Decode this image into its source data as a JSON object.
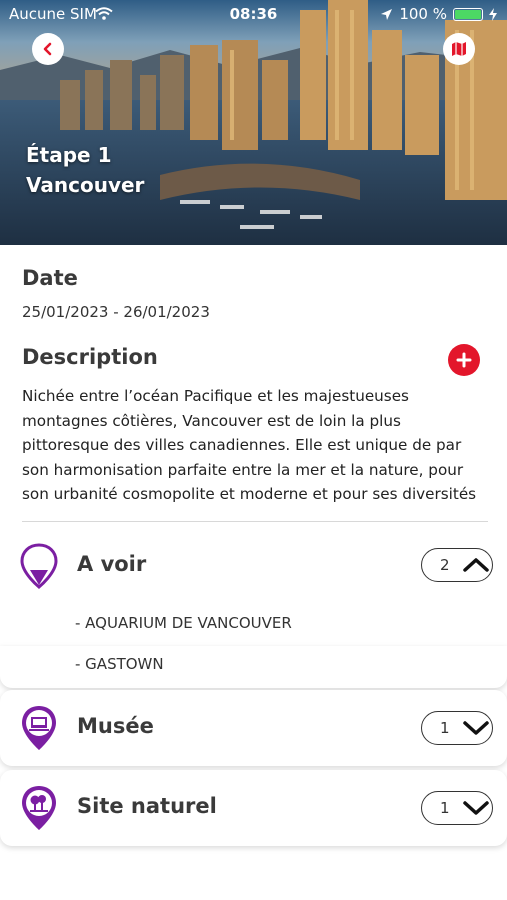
{
  "status_bar": {
    "carrier": "Aucune SIM",
    "time": "08:36",
    "battery": "100 %"
  },
  "hero": {
    "step": "Étape 1",
    "city": "Vancouver"
  },
  "date": {
    "title": "Date",
    "value": "25/01/2023 - 26/01/2023"
  },
  "description": {
    "title": "Description",
    "lines": [
      "Nichée entre l’océan Pacifique et les majestueuses",
      "montagnes côtières, Vancouver est de loin la plus",
      "pittoresque des villes canadiennes. Elle est unique de par",
      "son harmonisation parfaite entre la mer et la nature, pour",
      "son urbanité cosmopolite et moderne et pour ses diversités"
    ]
  },
  "categories": [
    {
      "label": "A voir",
      "count": "2",
      "expanded": true,
      "items": [
        "- AQUARIUM DE VANCOUVER",
        "- GASTOWN"
      ]
    },
    {
      "label": "Musée",
      "count": "1",
      "expanded": false
    },
    {
      "label": "Site naturel",
      "count": "1",
      "expanded": false
    }
  ],
  "colors": {
    "accent_purple": "#7b1fa2",
    "add_red": "#e3162b"
  },
  "icons": [
    "back-chevron-icon",
    "map-icon",
    "plus-icon",
    "location-pin-icon",
    "museum-icon",
    "nature-icon",
    "chevron-up-icon",
    "chevron-down-icon",
    "wifi-icon",
    "location-arrow-icon",
    "battery-icon",
    "charging-icon"
  ]
}
